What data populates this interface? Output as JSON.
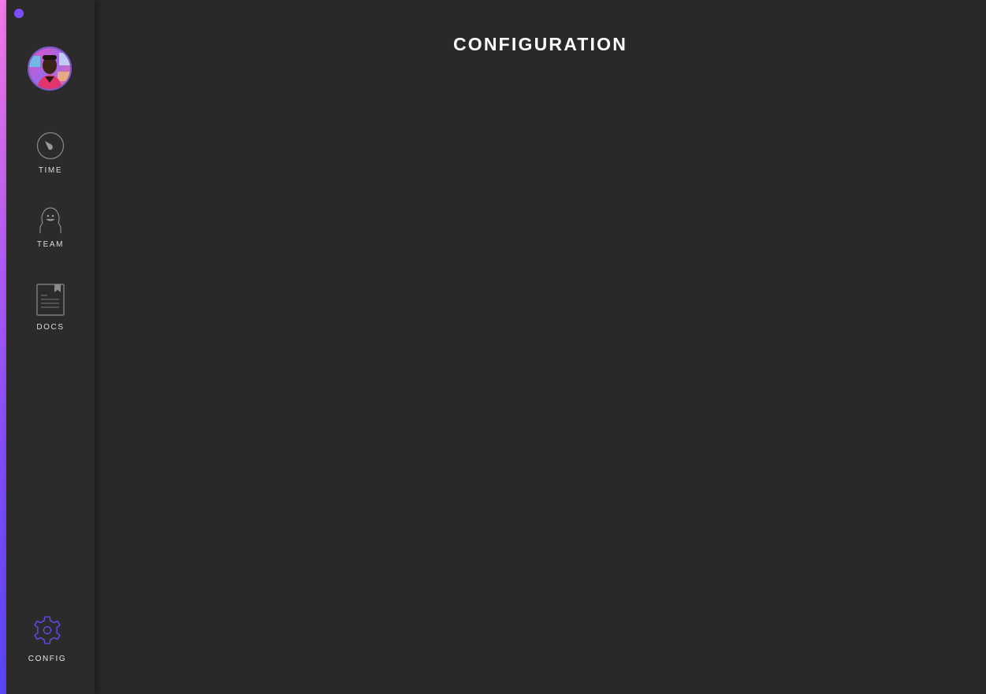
{
  "sidebar": {
    "items": [
      {
        "label": "TIME",
        "icon": "timer-icon"
      },
      {
        "label": "TEAM",
        "icon": "person-icon"
      },
      {
        "label": "DOCS",
        "icon": "document-icon"
      }
    ],
    "config": {
      "label": "CONFIG",
      "icon": "gear-icon"
    }
  },
  "main": {
    "title": "CONFIGURATION"
  },
  "colors": {
    "accent": "#7b4dff",
    "gradient_top": "#f77ae9",
    "gradient_bottom": "#5a45f7",
    "background": "#2a2829",
    "sidebar": "#2c2a2b"
  }
}
